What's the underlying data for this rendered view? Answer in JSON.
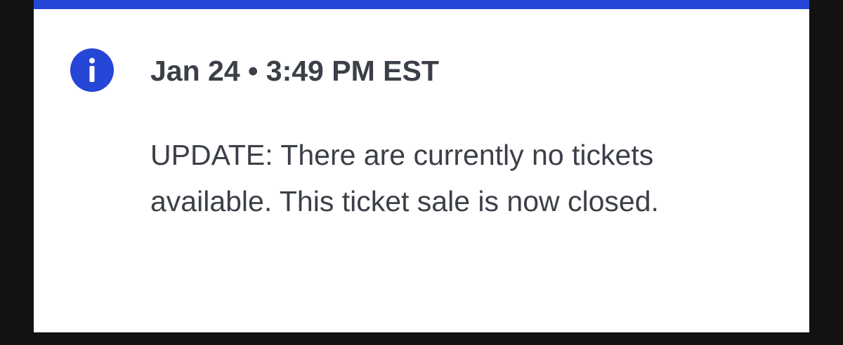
{
  "notice": {
    "icon": "info-icon",
    "accent_color": "#2546d6",
    "timestamp": "Jan 24 • 3:49 PM EST",
    "message": "UPDATE: There are currently no tickets available. This ticket sale is now closed."
  }
}
